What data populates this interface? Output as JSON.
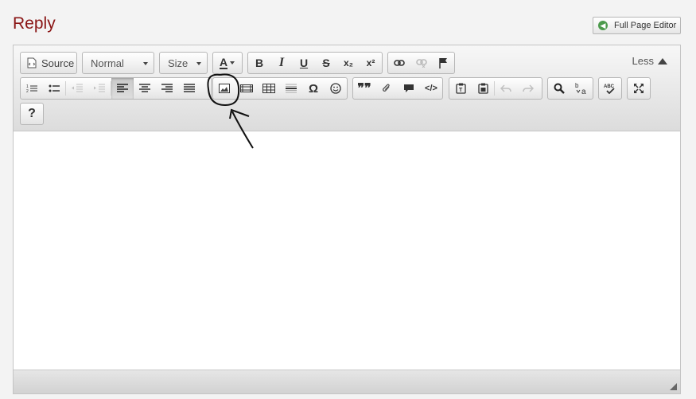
{
  "page": {
    "title": "Reply",
    "full_page_editor_label": "Full Page Editor"
  },
  "toolbar": {
    "source_label": "Source",
    "format_value": "Normal",
    "size_value": "Size",
    "less_label": "Less",
    "help_label": "?",
    "special_char_label": "Ω",
    "italic_label": "I",
    "bold_label": "B",
    "underline_label": "U",
    "strike_label": "S",
    "subscript_label": "x₂",
    "superscript_label": "x²",
    "textcolor_label": "A",
    "codeblock_label": "</>",
    "quote_label": "99"
  },
  "colors": {
    "title": "#8a1515",
    "full_page_editor_icon": "#4c9a4c",
    "annotation": "#111111"
  },
  "icons": [
    "document-icon",
    "numbered-list-icon",
    "bulleted-list-icon",
    "outdent-icon",
    "indent-icon",
    "align-left-icon",
    "align-center-icon",
    "align-right-icon",
    "justify-icon",
    "image-icon",
    "film-icon",
    "table-icon",
    "horizontal-rule-icon",
    "smiley-icon",
    "quote-icon",
    "paperclip-icon",
    "comment-icon",
    "code-icon",
    "paste-text-icon",
    "paste-word-icon",
    "undo-icon",
    "redo-icon",
    "search-icon",
    "replace-icon",
    "spellcheck-icon",
    "maximize-icon",
    "link-icon",
    "unlink-icon",
    "anchor-flag-icon"
  ]
}
